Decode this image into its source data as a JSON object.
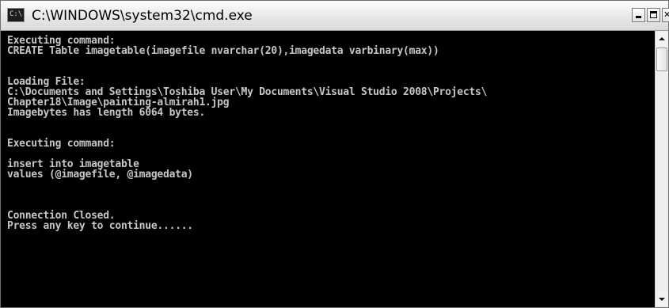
{
  "window": {
    "title": "C:\\WINDOWS\\system32\\cmd.exe",
    "icon": "cmd-icon",
    "icon_text": "C:\\"
  },
  "controls": [
    "minimize-icon",
    "maximize-icon",
    "close-icon"
  ],
  "console": {
    "lines": [
      "Executing command:",
      "CREATE Table imagetable(imagefile nvarchar(20),imagedata varbinary(max))",
      "",
      "",
      "Loading File:",
      "C:\\Documents and Settings\\Toshiba User\\My Documents\\Visual Studio 2008\\Projects\\",
      "Chapter18\\Image\\painting-almirah1.jpg",
      "Imagebytes has length 6064 bytes.",
      "",
      "",
      "Executing command:",
      "",
      "insert into imagetable",
      "values (@imagefile, @imagedata)",
      "",
      "",
      "",
      "Connection Closed.",
      "Press any key to continue......"
    ]
  },
  "colors": {
    "console_background": "#000000",
    "console_text": "#c6c6c6",
    "titlebar": "#e6e6e6"
  }
}
